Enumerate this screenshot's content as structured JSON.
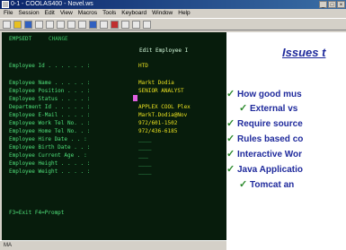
{
  "window": {
    "title": "0-1 - COOLAS400 - Novel.ws",
    "controls": [
      "_",
      "□",
      "×"
    ]
  },
  "menu": [
    "File",
    "Session",
    "Edit",
    "View",
    "Macros",
    "Tools",
    "Keyboard",
    "Window",
    "Help"
  ],
  "toolbar_icons": [
    "new-icon",
    "open-icon",
    "save-icon",
    "print-icon",
    "cut-icon",
    "copy-icon",
    "paste-icon",
    "undo-icon",
    "connect-icon",
    "disconnect-icon",
    "record-icon",
    "play-icon",
    "settings-icon",
    "help-icon"
  ],
  "terminal": {
    "program": "EMPSEDT",
    "mode": "CHANGE",
    "screen_title": "Edit Employee I",
    "fields": [
      {
        "label": "Employee Id . . . . . . :",
        "value": "HTD"
      },
      {
        "label": "Employee Name . . . . . :",
        "value": "Markt Dodia"
      },
      {
        "label": "Employee Position . . . :",
        "value": "SENIOR ANALYST"
      },
      {
        "label": "Employee Status . . . . :",
        "value": ""
      },
      {
        "label": "Department Id . . . . . :",
        "value": "APPLEX COOL Plex"
      },
      {
        "label": "Employee E-Mail . . . . :",
        "value": "MarkT.Dodia@Nov"
      },
      {
        "label": "Employee Work Tel No. . :",
        "value": "972/601-1502"
      },
      {
        "label": "Employee Home Tel No. . :",
        "value": "972/436-6185"
      },
      {
        "label": "Employee Hire Date . . :",
        "value": "____"
      },
      {
        "label": "Employee Birth Date . . :",
        "value": "____"
      },
      {
        "label": "Employee Current Age . :",
        "value": "___"
      },
      {
        "label": "Employee Height . . . . :",
        "value": "____"
      },
      {
        "label": "Employee Weight . . . . :",
        "value": "____"
      }
    ],
    "function_keys": "F3=Exit   F4=Prompt"
  },
  "status_bar": "MA",
  "slide": {
    "title": "Issues t",
    "bullets": [
      {
        "level": 1,
        "text": "How good mus"
      },
      {
        "level": 2,
        "text": "External vs"
      },
      {
        "level": 1,
        "text": "Require source"
      },
      {
        "level": 1,
        "text": "Rules based co"
      },
      {
        "level": 1,
        "text": "Interactive Wor"
      },
      {
        "level": 1,
        "text": "Java Applicatio"
      },
      {
        "level": 2,
        "text": "Tomcat an"
      }
    ],
    "check_glyph": "✓"
  },
  "colors": {
    "terminal_bg": "#071c0c",
    "terminal_text": "#4fe07a",
    "field_value": "#e8e020",
    "slide_text": "#1f2a9c",
    "check": "#2c8a2c"
  }
}
